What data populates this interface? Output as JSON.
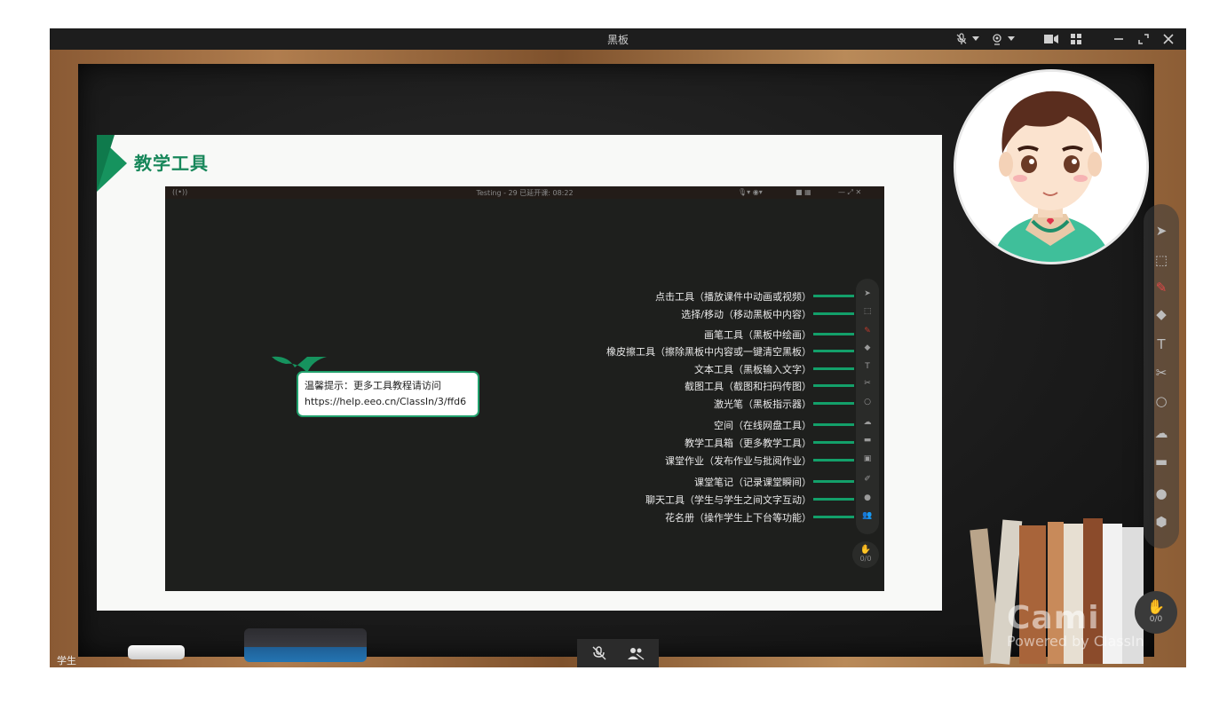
{
  "window": {
    "title": "黑板",
    "controls": {
      "mic": "mic-muted-icon",
      "camera": "camera-icon",
      "video": "video-icon",
      "layout": "grid-icon",
      "minimize": "—",
      "fullscreen": "⤢",
      "close": "✕"
    }
  },
  "slide": {
    "title": "教学工具",
    "accent_color": "#16935e",
    "screenshot": {
      "bar_title": "Testing - 29   已延开课: 08:22",
      "tool_labels": [
        "点击工具（播放课件中动画或视频）",
        "选择/移动（移动黑板中内容）",
        "画笔工具（黑板中绘画）",
        "橡皮擦工具（擦除黑板中内容或一键清空黑板）",
        "文本工具（黑板输入文字）",
        "截图工具（截图和扫码传图）",
        "激光笔（黑板指示器）",
        "空间（在线网盘工具）",
        "教学工具箱（更多教学工具）",
        "课堂作业（发布作业与批阅作业）",
        "课堂笔记（记录课堂瞬间）",
        "聊天工具（学生与学生之间文字互动）",
        "花名册（操作学生上下台等功能）"
      ],
      "pager": "0/0"
    },
    "tip": {
      "line1": "温馨提示：更多工具教程请访问",
      "line2": "https://help.eeo.cn/ClassIn/3/ffd6"
    }
  },
  "right_toolbar": [
    "pointer-icon",
    "select-icon",
    "pen-icon",
    "eraser-icon",
    "text-icon",
    "scissors-icon",
    "laser-icon",
    "cloud-icon",
    "toolbox-icon",
    "chat-icon",
    "roster-icon"
  ],
  "pager": "0/0",
  "watermark": {
    "brand": "Cami",
    "powered": "Powered by ClassIn"
  },
  "bottom_bar": {
    "mic": "mic-muted-icon",
    "students": "students-icon"
  },
  "student_label": "学生"
}
